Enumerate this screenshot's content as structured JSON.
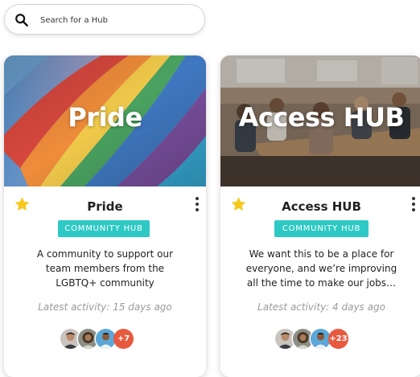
{
  "search": {
    "placeholder": "Search for a Hub",
    "value": ""
  },
  "cards": [
    {
      "hero_title": "Pride",
      "name": "Pride",
      "badge": "COMMUNITY HUB",
      "description": "A community to support our team members from the LGBTQ+ community",
      "activity": "Latest activity: 15 days ago",
      "more_count": "+7",
      "favorited": true
    },
    {
      "hero_title": "Access HUB",
      "name": "Access HUB",
      "badge": "COMMUNITY HUB",
      "description": "We want this to be a place for everyone, and we’re improving all the time to make our jobs…",
      "activity": "Latest activity: 4 days ago",
      "more_count": "+23",
      "favorited": true
    }
  ],
  "colors": {
    "badge": "#2ec9c5",
    "star": "#f7c81e",
    "more_badge": "#e85a3f",
    "activity_text": "#9a9a9a"
  },
  "icons": [
    "search-icon",
    "star-icon",
    "more-options-icon"
  ]
}
